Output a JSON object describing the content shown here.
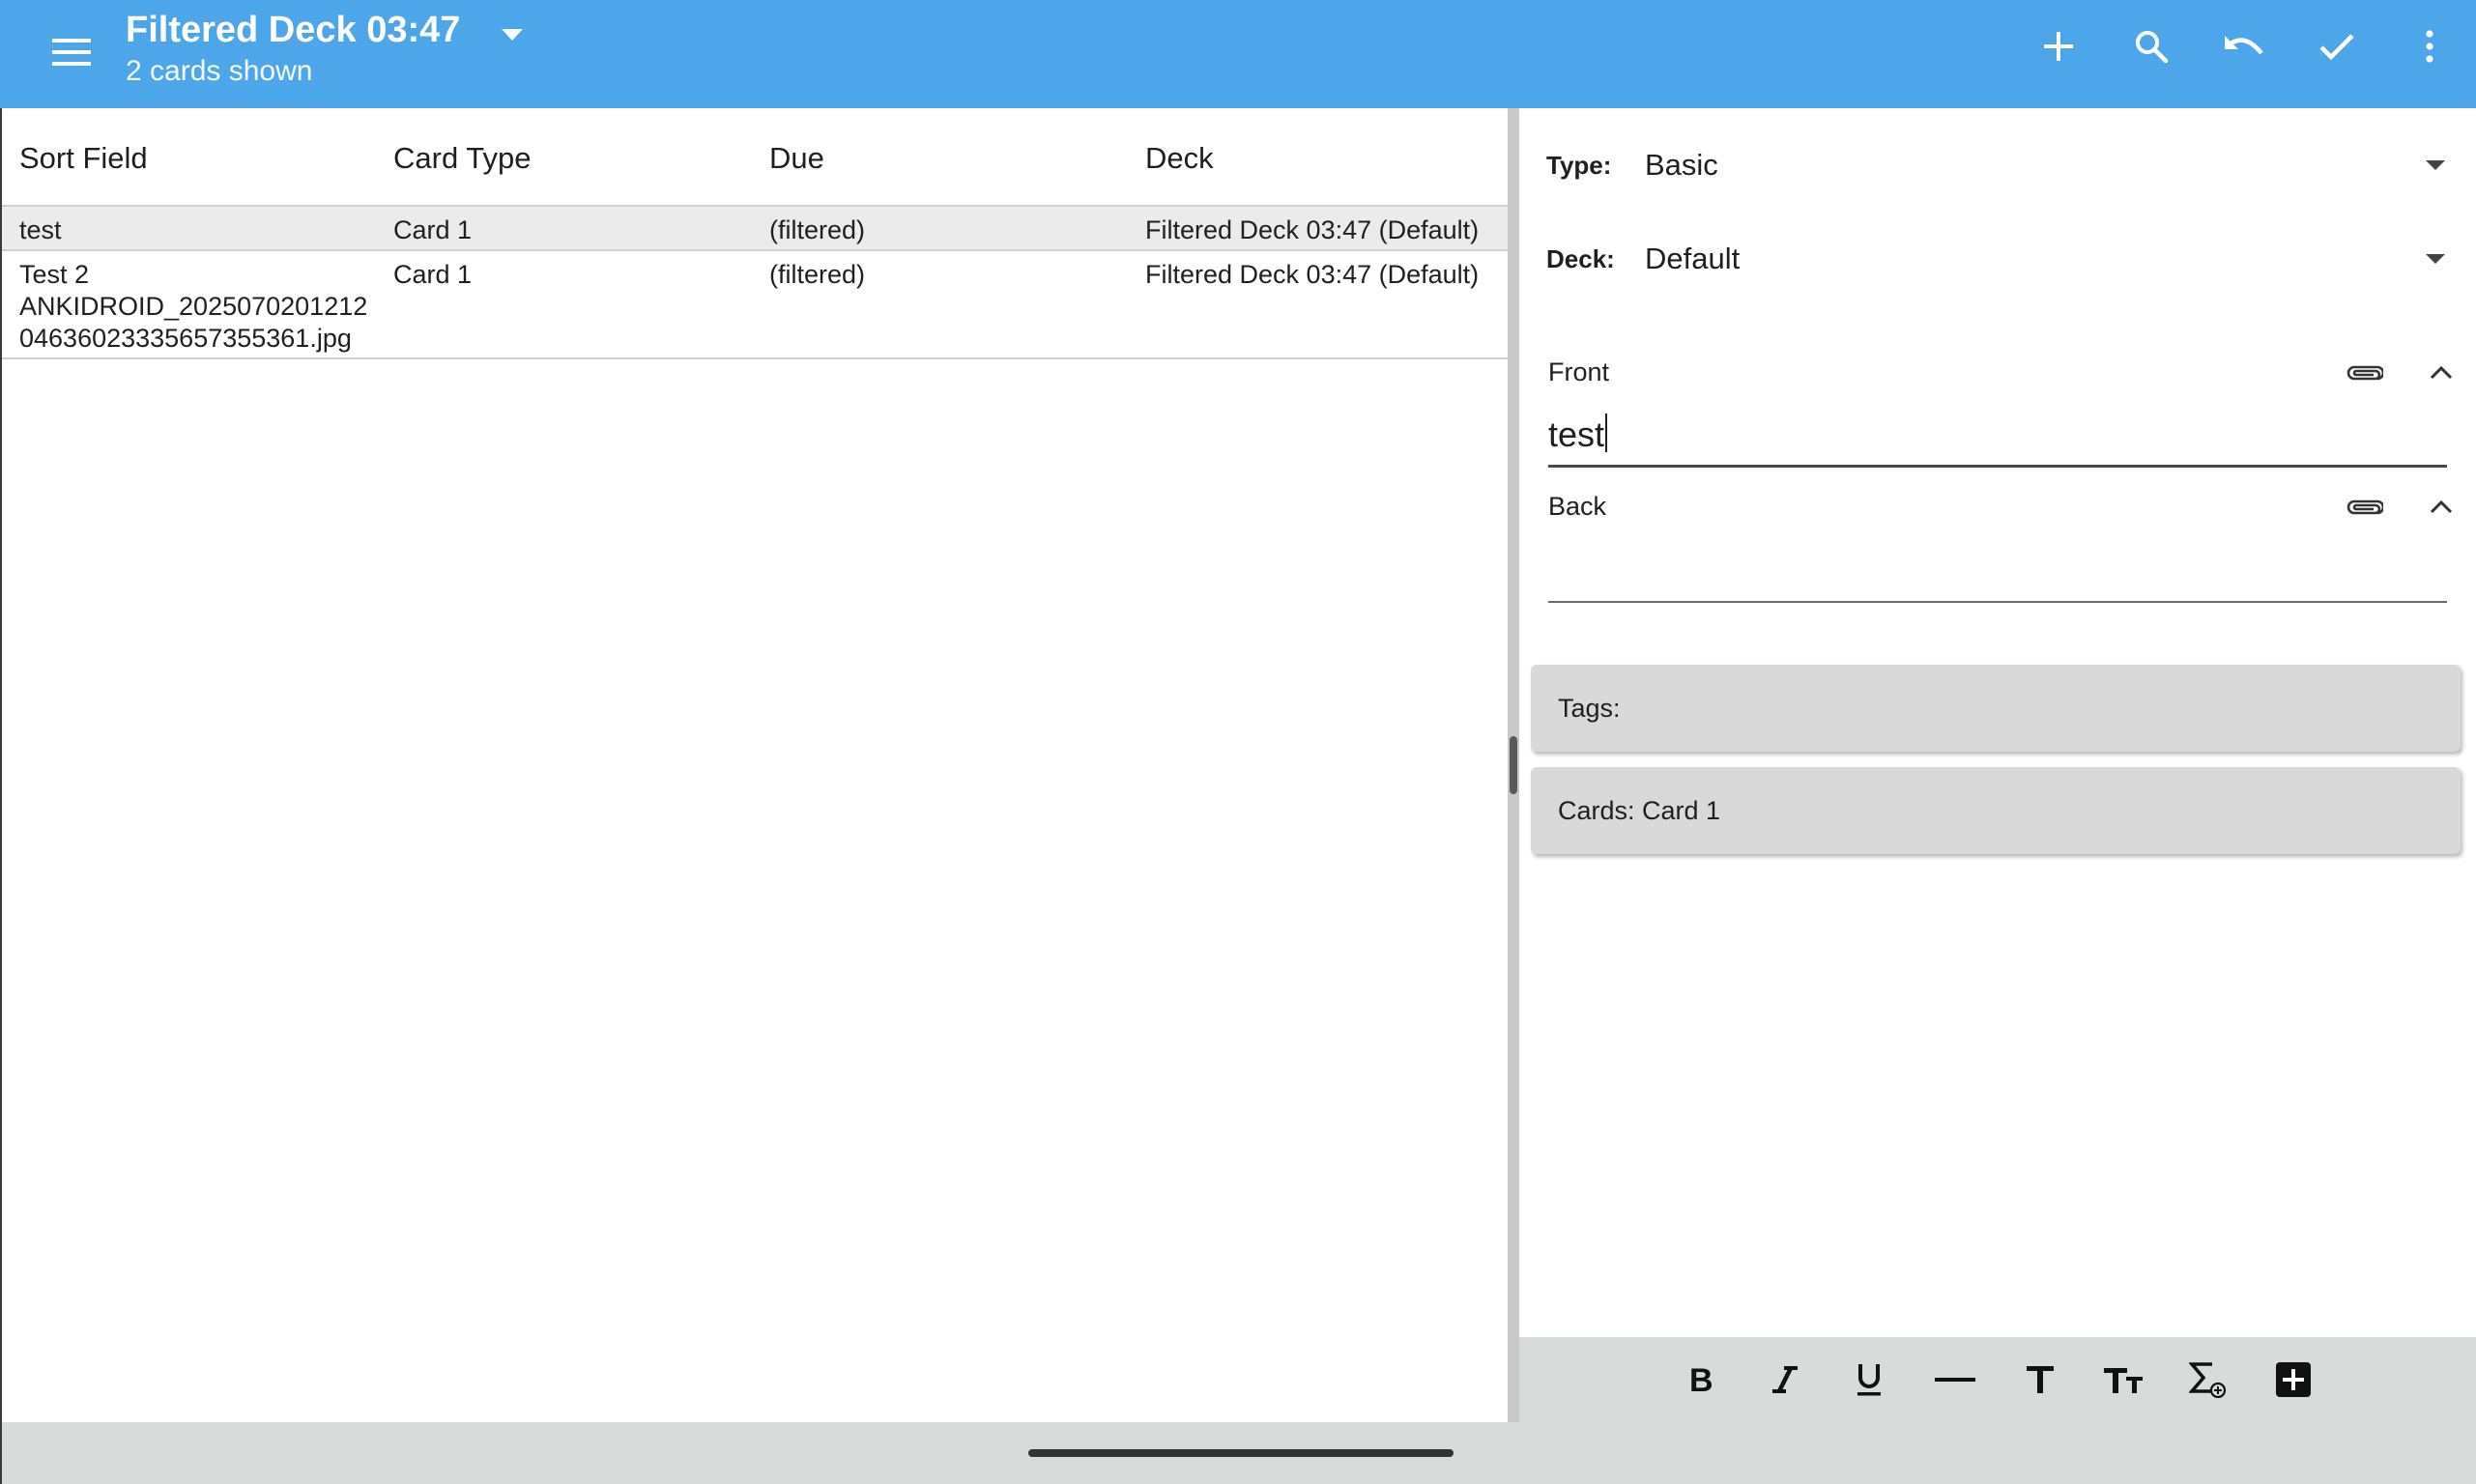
{
  "appbar": {
    "title": "Filtered Deck 03:47",
    "subtitle": "2 cards shown",
    "background": "#4ea6ea",
    "actions": [
      "add-icon",
      "search-icon",
      "undo-icon",
      "check-icon",
      "more-vert-icon"
    ]
  },
  "list": {
    "columns": [
      "Sort Field",
      "Card Type",
      "Due",
      "Deck"
    ],
    "rows": [
      {
        "sort_field": [
          "test"
        ],
        "card_type": "Card 1",
        "due": "(filtered)",
        "deck": "Filtered Deck 03:47 (Default)",
        "selected": true
      },
      {
        "sort_field": [
          "Test 2",
          "ANKIDROID_2025070201212",
          "04636023335657355361.jpg"
        ],
        "card_type": "Card 1",
        "due": "(filtered)",
        "deck": "Filtered Deck 03:47 (Default)",
        "selected": false
      }
    ]
  },
  "editor": {
    "type_label": "Type:",
    "type_value": "Basic",
    "deck_label": "Deck:",
    "deck_value": "Default",
    "fields": [
      {
        "label": "Front",
        "value": "test"
      },
      {
        "label": "Back",
        "value": ""
      }
    ],
    "tags_label": "Tags:",
    "cards_label": "Cards: Card 1"
  },
  "format_toolbar": [
    "bold-icon",
    "italic-icon",
    "underline-icon",
    "horizontal-rule-icon",
    "text-size-icon",
    "text-case-icon",
    "mathjax-icon",
    "add-custom-format-icon"
  ]
}
